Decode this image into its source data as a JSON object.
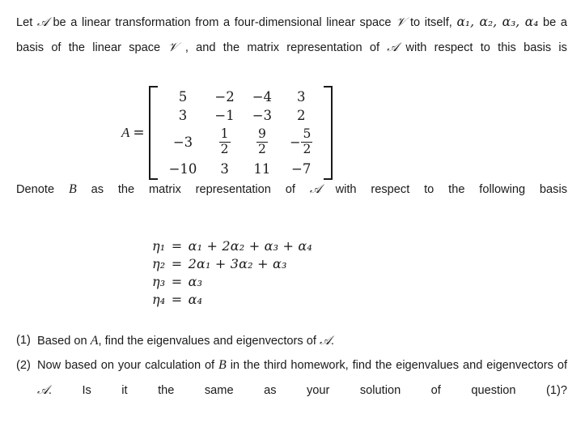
{
  "document": {
    "intro": {
      "seg1": "Let",
      "symbol_A_script": "𝒜",
      "seg2": "be a linear transformation from a four-dimensional linear space",
      "symbol_V_script": "𝒱",
      "seg3": "to itself,",
      "basis_vectors": "α₁, α₂, α₃, α₄",
      "seg4": "be a basis of the linear space",
      "symbol_V_script2": "𝒱",
      "seg5": ", and the matrix representation of",
      "symbol_A_script2": "𝒜",
      "seg6": "with respect to this basis is"
    },
    "matrix": {
      "label": "A",
      "equals": "=",
      "rows": [
        [
          "5",
          "−2",
          "−4",
          "3"
        ],
        [
          "3",
          "−1",
          "−3",
          "2"
        ],
        [
          "−3",
          "1/2",
          "9/2",
          "−5/2"
        ],
        [
          "−10",
          "3",
          "11",
          "−7"
        ]
      ],
      "row3_fractions": {
        "c1": "−3",
        "c2_num": "1",
        "c2_den": "2",
        "c2_sign": "",
        "c3_num": "9",
        "c3_den": "2",
        "c3_sign": "",
        "c4_num": "5",
        "c4_den": "2",
        "c4_sign": "−"
      }
    },
    "denote": {
      "seg1": "Denote",
      "symbol_B": "B",
      "seg2": "as the matrix representation of",
      "symbol_A_script": "𝒜",
      "seg3": "with respect to the following basis"
    },
    "basis_equations": [
      {
        "lhs": "η₁",
        "eq": "=",
        "rhs": "α₁ + 2α₂ + α₃ + α₄"
      },
      {
        "lhs": "η₂",
        "eq": "=",
        "rhs": "2α₁ + 3α₂ + α₃"
      },
      {
        "lhs": "η₃",
        "eq": "=",
        "rhs": "α₃"
      },
      {
        "lhs": "η₄",
        "eq": "=",
        "rhs": "α₄"
      }
    ],
    "questions": [
      {
        "number": "(1)",
        "seg1": "Based on",
        "symbol_A": "A",
        "seg2": ", find the eigenvalues and eigenvectors of",
        "symbol_A_script": "𝒜",
        "seg3": "."
      },
      {
        "number": "(2)",
        "seg1": "Now based on your calculation of",
        "symbol_B": "B",
        "seg2": "in the third homework, find the eigenvalues and eigenvectors of",
        "symbol_A_script": "𝒜",
        "seg3": ". Is it the same as your solution of question (1)?"
      }
    ]
  }
}
